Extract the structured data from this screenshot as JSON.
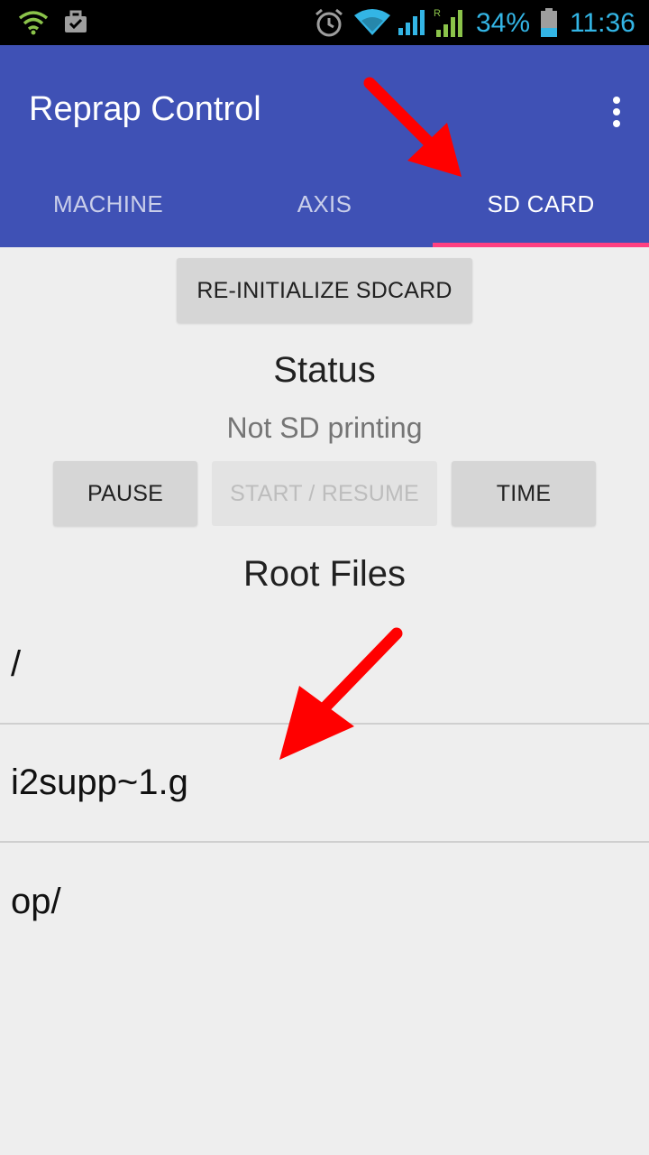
{
  "status_bar": {
    "battery_percent": "34%",
    "time": "11:36",
    "icons": [
      "wifi-signal-icon",
      "briefcase-check-icon",
      "alarm-icon",
      "wifi-icon",
      "cell-signal-icon",
      "cell-signal-roaming-icon",
      "battery-icon"
    ],
    "accent_color": "#33b5e5"
  },
  "app_bar": {
    "title": "Reprap Control",
    "color": "#3f51b5",
    "overflow_icon": "more-vert-icon"
  },
  "tabs": [
    {
      "label": "MACHINE",
      "active": false
    },
    {
      "label": "AXIS",
      "active": false
    },
    {
      "label": "SD CARD",
      "active": true
    }
  ],
  "tab_indicator_color": "#ff4081",
  "sdcard": {
    "reinit_label": "RE-INITIALIZE SDCARD",
    "status_heading": "Status",
    "status_text": "Not SD printing",
    "controls": {
      "pause_label": "PAUSE",
      "start_resume_label": "START / RESUME",
      "time_label": "TIME"
    },
    "files_heading": "Root Files",
    "files": [
      "/",
      "i2supp~1.g",
      "op/"
    ]
  },
  "annotation_color": "#ff0000"
}
